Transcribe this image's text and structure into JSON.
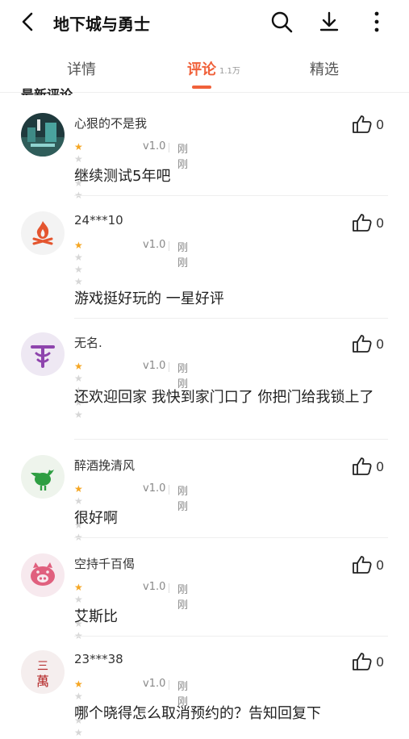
{
  "header": {
    "title": "地下城与勇士"
  },
  "tabs": [
    {
      "label": "详情",
      "active": false
    },
    {
      "label": "评论",
      "active": true,
      "count": "1.1万"
    },
    {
      "label": "精选",
      "active": false
    }
  ],
  "section_title": "最新评论",
  "accent_color": "#f0613a",
  "comments": [
    {
      "user": "心狠的不是我",
      "rating": 1,
      "version": "v1.0",
      "time": "刚刚",
      "likes": "0",
      "text": "继续测试5年吧"
    },
    {
      "user": "24***10",
      "rating": 1,
      "version": "v1.0",
      "time": "刚刚",
      "likes": "0",
      "text": "游戏挺好玩的 一星好评"
    },
    {
      "user": "无名.",
      "rating": 1,
      "version": "v1.0",
      "time": "刚刚",
      "likes": "0",
      "text": "还欢迎回家 我快到家门口了 你把门给我锁上了"
    },
    {
      "user": "醉酒挽清风",
      "rating": 1,
      "version": "v1.0",
      "time": "刚刚",
      "likes": "0",
      "text": "很好啊"
    },
    {
      "user": "空持千百偈",
      "rating": 1,
      "version": "v1.0",
      "time": "刚刚",
      "likes": "0",
      "text": "艾斯比"
    },
    {
      "user": "23***38",
      "rating": 1,
      "version": "v1.0",
      "time": "刚刚",
      "likes": "0",
      "text": "哪个晓得怎么取消预约的？告知回复下",
      "avatar_text": "三萬"
    }
  ]
}
